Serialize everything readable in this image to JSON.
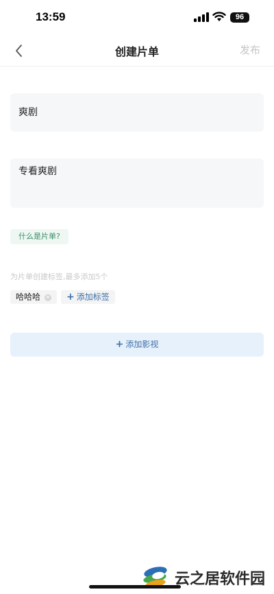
{
  "status_bar": {
    "time": "13:59",
    "battery": "96"
  },
  "nav": {
    "title": "创建片单",
    "publish_label": "发布"
  },
  "form": {
    "name_value": "爽剧",
    "description_value": "专看爽剧",
    "what_is_label": "什么是片单?",
    "tag_hint": "为片单创建标签,最多添加5个",
    "tags": [
      "哈哈哈"
    ],
    "add_tag_label": "添加标签",
    "add_video_label": "添加影视"
  },
  "watermark": {
    "text": "云之居软件园"
  },
  "colors": {
    "accent_blue": "#3d6fa8",
    "accent_green": "#3a8c6b",
    "field_bg": "#f6f7f9"
  }
}
